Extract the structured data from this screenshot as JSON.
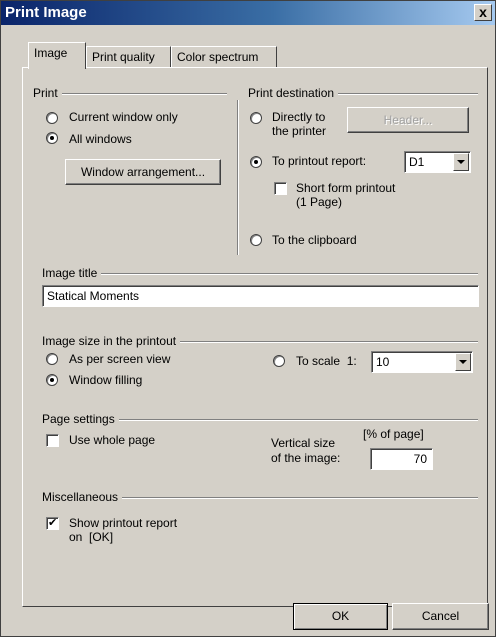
{
  "window": {
    "title": "Print Image",
    "close_glyph": "x"
  },
  "tabs": [
    {
      "label": "Image",
      "active": true
    },
    {
      "label": "Print quality",
      "active": false
    },
    {
      "label": "Color spectrum",
      "active": false
    }
  ],
  "print": {
    "label": "Print",
    "current_window_only": "Current window only",
    "all_windows": "All windows",
    "selected": "all_windows",
    "window_arrangement_button": "Window arrangement..."
  },
  "destination": {
    "label": "Print destination",
    "directly_line1": "Directly to",
    "directly_line2": "the printer",
    "header_button": "Header...",
    "to_report": "To printout report:",
    "report_select_value": "D1",
    "short_form_line1": "Short form printout",
    "short_form_line2": "(1 Page)",
    "short_form_checked": false,
    "to_clipboard": "To the clipboard",
    "selected": "to_report"
  },
  "image_title": {
    "label": "Image title",
    "value": "Statical Moments"
  },
  "image_size": {
    "label": "Image size in the printout",
    "as_per_screen": "As per screen view",
    "window_filling": "Window filling",
    "to_scale": "To scale  1:",
    "scale_value": "10",
    "selected": "window_filling"
  },
  "page_settings": {
    "label": "Page settings",
    "use_whole_page": "Use whole page",
    "use_whole_page_checked": false,
    "vertical_size_line1": "Vertical size",
    "vertical_size_line2": "of the image:",
    "unit": "[% of page]",
    "vertical_value": "70"
  },
  "misc": {
    "label": "Miscellaneous",
    "show_report_line1": "Show printout report",
    "show_report_line2": "on  [OK]",
    "show_report_checked": true
  },
  "footer": {
    "ok": "OK",
    "cancel": "Cancel"
  }
}
